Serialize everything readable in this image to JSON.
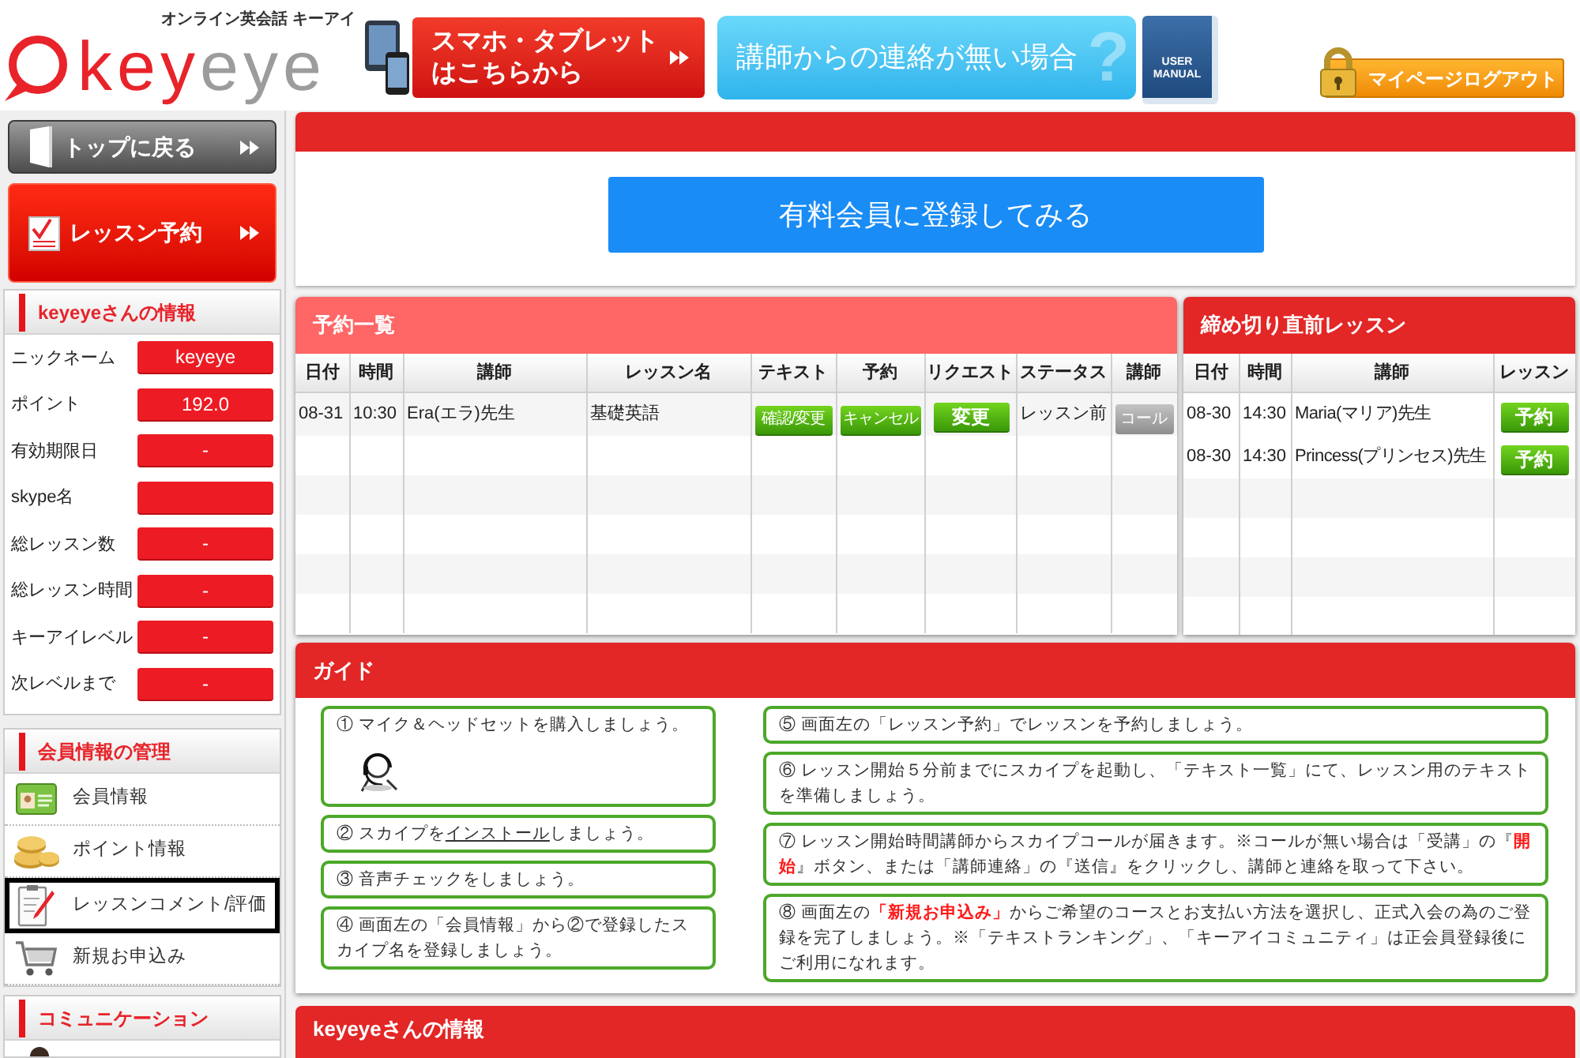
{
  "header": {
    "tagline": "オンライン英会話 キーアイ",
    "logo": {
      "accent": "key",
      "rest": "eye"
    },
    "mobile_banner": "スマホ・タブレットはこちらから",
    "contact_banner": {
      "label": "講師からの連絡が無い場合",
      "decoration": "?"
    },
    "manual": "USER\nMANUAL",
    "logout": "マイページログアウト"
  },
  "sidebar": {
    "nav_buttons": [
      {
        "label": "トップに戻る",
        "kind": "back"
      },
      {
        "label": "レッスン予約",
        "kind": "reserve"
      }
    ],
    "profile": {
      "title": "keyeyeさんの情報",
      "fields": [
        {
          "label": "ニックネーム",
          "value": "keyeye"
        },
        {
          "label": "ポイント",
          "value": "192.0"
        },
        {
          "label": "有効期限日",
          "value": "-"
        },
        {
          "label": "skype名"
        },
        {
          "label": "総レッスン数",
          "value": "-"
        },
        {
          "label": "総レッスン時間",
          "value": "-"
        },
        {
          "label": "キーアイレベル",
          "value": "-"
        },
        {
          "label": "次レベルまで",
          "value": "-"
        }
      ]
    },
    "member_menu": {
      "title": "会員情報の管理",
      "items": [
        {
          "label": "会員情報",
          "kind": "account",
          "selected": false
        },
        {
          "label": "ポイント情報",
          "kind": "points",
          "selected": false
        },
        {
          "label": "レッスンコメント/評価",
          "kind": "review",
          "selected": true
        },
        {
          "label": "新規お申込み",
          "kind": "signup",
          "selected": false
        }
      ]
    },
    "communication": {
      "title": "コミュニケーション",
      "items": [
        {
          "kind": "member"
        }
      ]
    }
  },
  "main": {
    "promo_button": "有料会員に登録してみる",
    "reservations": {
      "title": "予約一覧",
      "columns": [
        "日付",
        "時間",
        "講師",
        "レッスン名",
        "テキスト",
        "予約",
        "リクエスト",
        "ステータス",
        "講師"
      ],
      "rows": [
        {
          "date": "08-31",
          "time": "10:30",
          "teacher": "Era(エラ)先生",
          "lesson": "基礎英語",
          "text_button": "確認/変更",
          "reserve_button": "キャンセル",
          "request_button": "変更",
          "status": "レッスン前",
          "call_button": {
            "label": "コール",
            "disabled": true
          }
        }
      ]
    },
    "deadline_lessons": {
      "title": "締め切り直前レッスン",
      "columns": [
        "日付",
        "時間",
        "講師",
        "レッスン"
      ],
      "rows": [
        {
          "date": "08-30",
          "time": "14:30",
          "teacher": "Maria(マリア)先生",
          "button": "予約"
        },
        {
          "date": "08-30",
          "time": "14:30",
          "teacher": "Princess(プリンセス)先生",
          "button": "予約"
        }
      ]
    },
    "guide": {
      "title": "ガイド",
      "left_steps": [
        {
          "kind": "illustrated",
          "parts": [
            {
              "kind": "plain",
              "text": "① マイク＆ヘッドセットを購入しましょう。"
            }
          ]
        },
        {
          "kind": "plain",
          "parts": [
            {
              "kind": "plain",
              "text": "② スカイプを"
            },
            {
              "kind": "link",
              "text": "インストール"
            },
            {
              "kind": "plain",
              "text": "しましょう。"
            }
          ]
        },
        {
          "kind": "plain",
          "parts": [
            {
              "kind": "plain",
              "text": "③ 音声チェックをしましょう。"
            }
          ]
        },
        {
          "kind": "plain",
          "parts": [
            {
              "kind": "plain",
              "text": "④ 画面左の「会員情報」から②で登録したスカイプ名を登録しましょう。"
            }
          ]
        }
      ],
      "right_steps": [
        {
          "kind": "plain",
          "parts": [
            {
              "kind": "plain",
              "text": "⑤ 画面左の「レッスン予約」でレッスンを予約しましょう。"
            }
          ]
        },
        {
          "kind": "plain",
          "parts": [
            {
              "kind": "plain",
              "text": "⑥ レッスン開始５分前までにスカイプを起動し、「テキスト一覧」にて、レッスン用のテキストを準備しましょう。"
            }
          ]
        },
        {
          "kind": "plain",
          "parts": [
            {
              "kind": "plain",
              "text": "⑦ レッスン開始時間講師からスカイプコールが届きます。※コールが無い場合は「受講」の『"
            },
            {
              "kind": "highlight",
              "text": "開始"
            },
            {
              "kind": "plain",
              "text": "』ボタン、または「講師連絡」の『送信』をクリックし、講師と連絡を取って下さい。"
            }
          ]
        },
        {
          "kind": "plain",
          "parts": [
            {
              "kind": "plain",
              "text": "⑧ 画面左の"
            },
            {
              "kind": "highlight",
              "text": "「新規お申込み」"
            },
            {
              "kind": "plain",
              "text": "からご希望のコースとお支払い方法を選択し、正式入会の為のご登録を完了しましょう。※「テキストランキング」、「キーアイコミュニティ」は正会員登録後にご利用になれます。"
            }
          ]
        }
      ]
    },
    "profile_panel": {
      "title": "keyeyeさんの情報"
    }
  }
}
